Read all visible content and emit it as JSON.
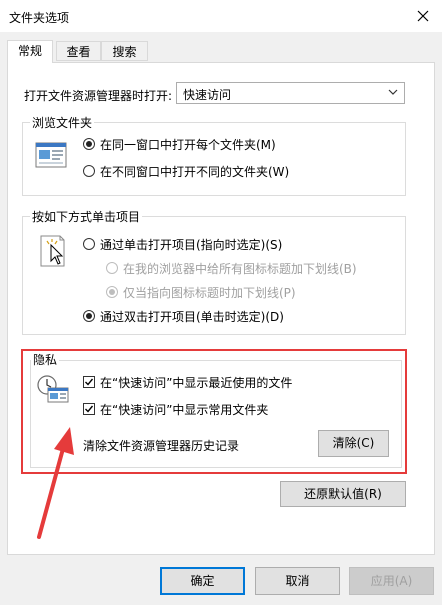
{
  "window": {
    "title": "文件夹选项"
  },
  "tabs": [
    {
      "label": "常规"
    },
    {
      "label": "查看"
    },
    {
      "label": "搜索"
    }
  ],
  "open_with": {
    "label": "打开文件资源管理器时打开:",
    "value": "快速访问"
  },
  "browse": {
    "title": "浏览文件夹",
    "options": [
      {
        "label": "在同一窗口中打开每个文件夹(M)",
        "checked": true
      },
      {
        "label": "在不同窗口中打开不同的文件夹(W)",
        "checked": false
      }
    ]
  },
  "click": {
    "title": "按如下方式单击项目",
    "single": {
      "label": "通过单击打开项目(指向时选定)(S)",
      "checked": false
    },
    "sub1": {
      "label": "在我的浏览器中给所有图标标题加下划线(B)",
      "checked": false
    },
    "sub2": {
      "label": "仅当指向图标标题时加下划线(P)",
      "checked": true
    },
    "double": {
      "label": "通过双击打开项目(单击时选定)(D)",
      "checked": true
    }
  },
  "privacy": {
    "title": "隐私",
    "recent": {
      "label": "在“快速访问”中显示最近使用的文件",
      "checked": true
    },
    "frequent": {
      "label": "在“快速访问”中显示常用文件夹",
      "checked": true
    },
    "clear_history": "清除文件资源管理器历史记录",
    "clear_button": "清除(C)"
  },
  "restore_button": "还原默认值(R)",
  "footer": {
    "ok": "确定",
    "cancel": "取消",
    "apply": "应用(A)"
  },
  "colors": {
    "highlight_box": "#e53b3b",
    "arrow": "#e53b3b",
    "accent": "#0078d7"
  }
}
